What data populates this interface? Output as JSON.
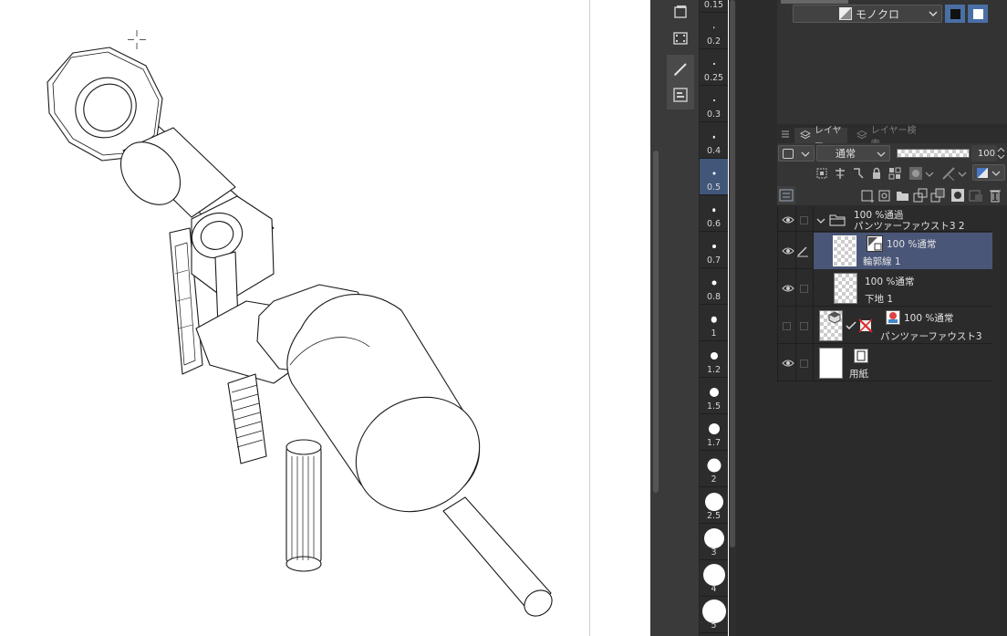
{
  "properties": {
    "color_mode_value": "モノクロ",
    "color_mode_icon": "monochrome-icon"
  },
  "brush_sizes": [
    {
      "label": "0.15",
      "selected": false
    },
    {
      "label": "0.2",
      "selected": false
    },
    {
      "label": "0.25",
      "selected": false
    },
    {
      "label": "0.3",
      "selected": false
    },
    {
      "label": "0.4",
      "selected": false
    },
    {
      "label": "0.5",
      "selected": true
    },
    {
      "label": "0.6",
      "selected": false
    },
    {
      "label": "0.7",
      "selected": false
    },
    {
      "label": "0.8",
      "selected": false
    },
    {
      "label": "1",
      "selected": false
    },
    {
      "label": "1.2",
      "selected": false
    },
    {
      "label": "1.5",
      "selected": false
    },
    {
      "label": "1.7",
      "selected": false
    },
    {
      "label": "2",
      "selected": false
    },
    {
      "label": "2.5",
      "selected": false
    },
    {
      "label": "3",
      "selected": false
    },
    {
      "label": "4",
      "selected": false
    },
    {
      "label": "5",
      "selected": false
    }
  ],
  "layer_panel": {
    "tabs": [
      {
        "label": "レイヤー",
        "icon": "layers-icon",
        "active": true
      },
      {
        "label": "レイヤー検索",
        "icon": "layer-search-icon",
        "active": false
      }
    ],
    "blend_mode": "通常",
    "opacity": "100",
    "layers": [
      {
        "name": "パンツァーファウスト3 2",
        "status": "100 %通過",
        "type": "folder",
        "visible": true,
        "selected": false
      },
      {
        "name": "輪郭線 1",
        "status": "100 %通常",
        "type": "vector",
        "visible": true,
        "selected": true
      },
      {
        "name": "下地 1",
        "status": "100 %通常",
        "type": "raster",
        "visible": true,
        "selected": false
      },
      {
        "name": "パンツァーファウスト3",
        "status": "100 %通常",
        "type": "3d",
        "visible": false,
        "selected": false
      },
      {
        "name": "用紙",
        "status": "",
        "type": "paper",
        "visible": true,
        "selected": false
      }
    ]
  },
  "colors": {
    "selection": "#4a5678",
    "brush_selection": "#41577a",
    "accent": "#4a6fa5",
    "panel_bg": "#2b2b2b"
  }
}
